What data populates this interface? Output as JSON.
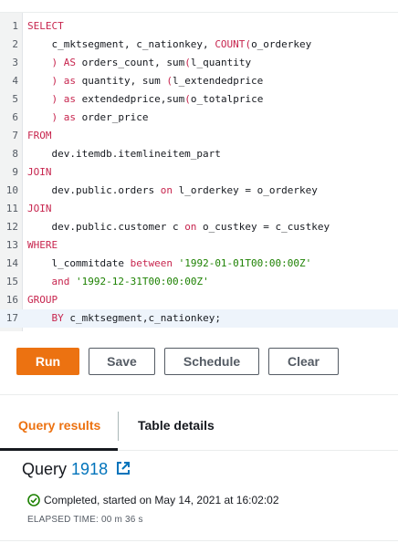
{
  "editor": {
    "lines": [
      {
        "n": "1",
        "parts": [
          [
            "kw",
            "SELECT"
          ]
        ]
      },
      {
        "n": "2",
        "parts": [
          [
            "",
            "    c_mktsegment, c_nationkey, "
          ],
          [
            "kw",
            "COUNT"
          ],
          [
            "paren",
            "("
          ],
          [
            "",
            "o_orderkey"
          ]
        ]
      },
      {
        "n": "3",
        "parts": [
          [
            "",
            "    "
          ],
          [
            "paren",
            ")"
          ],
          [
            "",
            ""
          ],
          [
            "kw",
            " AS"
          ],
          [
            "",
            " orders_count, sum"
          ],
          [
            "paren",
            "("
          ],
          [
            "",
            "l_quantity"
          ]
        ]
      },
      {
        "n": "4",
        "parts": [
          [
            "",
            "    "
          ],
          [
            "paren",
            ")"
          ],
          [
            "kw",
            " as"
          ],
          [
            "",
            " quantity, sum "
          ],
          [
            "paren",
            "("
          ],
          [
            "",
            "l_extendedprice"
          ]
        ]
      },
      {
        "n": "5",
        "parts": [
          [
            "",
            "    "
          ],
          [
            "paren",
            ")"
          ],
          [
            "kw",
            " as"
          ],
          [
            "",
            " extendedprice,sum"
          ],
          [
            "paren",
            "("
          ],
          [
            "",
            "o_totalprice"
          ]
        ]
      },
      {
        "n": "6",
        "parts": [
          [
            "",
            "    "
          ],
          [
            "paren",
            ")"
          ],
          [
            "kw",
            " as"
          ],
          [
            "",
            " order_price"
          ]
        ]
      },
      {
        "n": "7",
        "parts": [
          [
            "kw",
            "FROM"
          ]
        ]
      },
      {
        "n": "8",
        "parts": [
          [
            "",
            "    dev.itemdb.itemlineitem_part"
          ]
        ]
      },
      {
        "n": "9",
        "parts": [
          [
            "kw",
            "JOIN"
          ]
        ]
      },
      {
        "n": "10",
        "parts": [
          [
            "",
            "    dev.public.orders "
          ],
          [
            "kw",
            "on"
          ],
          [
            "",
            " l_orderkey = o_orderkey"
          ]
        ]
      },
      {
        "n": "11",
        "parts": [
          [
            "kw",
            "JOIN"
          ]
        ]
      },
      {
        "n": "12",
        "parts": [
          [
            "",
            "    dev.public.customer c "
          ],
          [
            "kw",
            "on"
          ],
          [
            "",
            " o_custkey = c_custkey"
          ]
        ]
      },
      {
        "n": "13",
        "parts": [
          [
            "kw",
            "WHERE"
          ]
        ]
      },
      {
        "n": "14",
        "parts": [
          [
            "",
            "    l_commitdate "
          ],
          [
            "kw",
            "between"
          ],
          [
            "",
            " "
          ],
          [
            "str",
            "'1992-01-01T00:00:00Z'"
          ]
        ]
      },
      {
        "n": "15",
        "parts": [
          [
            "",
            "    "
          ],
          [
            "kw",
            "and"
          ],
          [
            "",
            " "
          ],
          [
            "str",
            "'1992-12-31T00:00:00Z'"
          ]
        ]
      },
      {
        "n": "16",
        "parts": [
          [
            "kw",
            "GROUP"
          ]
        ]
      },
      {
        "n": "17",
        "parts": [
          [
            "",
            "    "
          ],
          [
            "kw",
            "BY"
          ],
          [
            "",
            " c_mktsegment,c_nationkey;"
          ]
        ]
      }
    ],
    "active_line": 17
  },
  "toolbar": {
    "run_label": "Run",
    "save_label": "Save",
    "schedule_label": "Schedule",
    "clear_label": "Clear"
  },
  "tabs": {
    "query_results": "Query results",
    "table_details": "Table details"
  },
  "query": {
    "title_prefix": "Query",
    "number": "1918",
    "status": "Completed, started on May 14, 2021 at 16:02:02",
    "elapsed": "ELAPSED TIME: 00 m 36 s"
  },
  "colors": {
    "accent": "#ec7211",
    "link": "#0073bb",
    "success": "#1d8102"
  }
}
